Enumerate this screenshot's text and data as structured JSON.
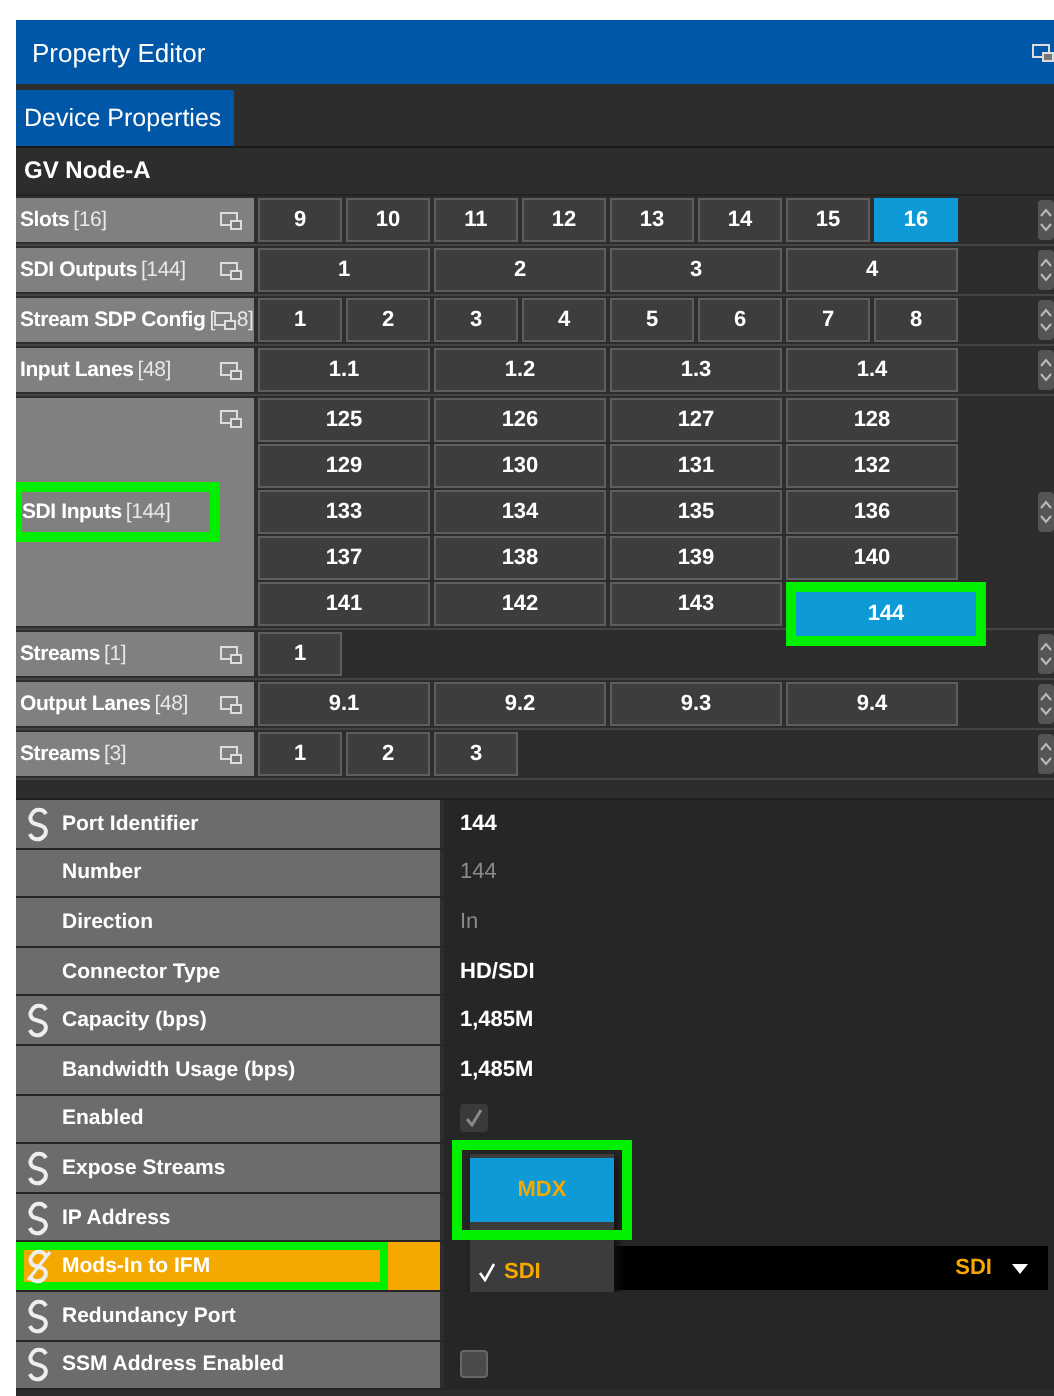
{
  "window": {
    "title": "Property Editor"
  },
  "tabs": [
    {
      "label": "Device Properties",
      "selected": true
    }
  ],
  "device": "GV Node-A",
  "grid": [
    {
      "label": "Slots",
      "count": "[16]",
      "cell_rows": [
        [
          {
            "text": "9",
            "selected": false
          },
          {
            "text": "10",
            "selected": false
          },
          {
            "text": "11",
            "selected": false
          },
          {
            "text": "12",
            "selected": false
          },
          {
            "text": "13",
            "selected": false
          },
          {
            "text": "14",
            "selected": false
          },
          {
            "text": "15",
            "selected": false
          },
          {
            "text": "16",
            "selected": true
          }
        ]
      ]
    },
    {
      "label": "SDI Outputs",
      "count": "[144]",
      "cell_rows": [
        [
          {
            "text": "1",
            "selected": false
          },
          {
            "text": "2",
            "selected": false
          },
          {
            "text": "3",
            "selected": false
          },
          {
            "text": "4",
            "selected": false
          }
        ]
      ]
    },
    {
      "label": "Stream SDP Config",
      "count": "[",
      "count_tail": "8]",
      "cell_rows": [
        [
          {
            "text": "1",
            "selected": false
          },
          {
            "text": "2",
            "selected": false
          },
          {
            "text": "3",
            "selected": false
          },
          {
            "text": "4",
            "selected": false
          },
          {
            "text": "5",
            "selected": false
          },
          {
            "text": "6",
            "selected": false
          },
          {
            "text": "7",
            "selected": false
          },
          {
            "text": "8",
            "selected": false
          }
        ]
      ]
    },
    {
      "label": "Input Lanes",
      "count": "[48]",
      "cell_rows": [
        [
          {
            "text": "1.1",
            "selected": false
          },
          {
            "text": "1.2",
            "selected": false
          },
          {
            "text": "1.3",
            "selected": false
          },
          {
            "text": "1.4",
            "selected": false
          }
        ]
      ]
    },
    {
      "label": "SDI Inputs",
      "count": "[144]",
      "highlighted": true,
      "cell_rows": [
        [
          {
            "text": "125",
            "selected": false
          },
          {
            "text": "126",
            "selected": false
          },
          {
            "text": "127",
            "selected": false
          },
          {
            "text": "128",
            "selected": false
          }
        ],
        [
          {
            "text": "129",
            "selected": false
          },
          {
            "text": "130",
            "selected": false
          },
          {
            "text": "131",
            "selected": false
          },
          {
            "text": "132",
            "selected": false
          }
        ],
        [
          {
            "text": "133",
            "selected": false
          },
          {
            "text": "134",
            "selected": false
          },
          {
            "text": "135",
            "selected": false
          },
          {
            "text": "136",
            "selected": false
          }
        ],
        [
          {
            "text": "137",
            "selected": false
          },
          {
            "text": "138",
            "selected": false
          },
          {
            "text": "139",
            "selected": false
          },
          {
            "text": "140",
            "selected": false
          }
        ],
        [
          {
            "text": "141",
            "selected": false
          },
          {
            "text": "142",
            "selected": false
          },
          {
            "text": "143",
            "selected": false
          },
          {
            "text": "144",
            "selected": true,
            "highlighted": true
          }
        ]
      ]
    },
    {
      "label": "Streams",
      "count": "[1]",
      "cell_rows": [
        [
          {
            "text": "1",
            "selected": false
          }
        ]
      ]
    },
    {
      "label": "Output Lanes",
      "count": "[48]",
      "cell_rows": [
        [
          {
            "text": "9.1",
            "selected": false
          },
          {
            "text": "9.2",
            "selected": false
          },
          {
            "text": "9.3",
            "selected": false
          },
          {
            "text": "9.4",
            "selected": false
          }
        ]
      ]
    },
    {
      "label": "Streams",
      "count": "[3]",
      "cell_rows": [
        [
          {
            "text": "1",
            "selected": false
          },
          {
            "text": "2",
            "selected": false
          },
          {
            "text": "3",
            "selected": false
          }
        ]
      ]
    }
  ],
  "properties": [
    {
      "label": "Port Identifier",
      "linked": true,
      "kind": "text",
      "value": "144",
      "readonly": false
    },
    {
      "label": "Number",
      "kind": "text",
      "value": "144",
      "readonly": true
    },
    {
      "label": "Direction",
      "kind": "text",
      "value": "In",
      "readonly": true
    },
    {
      "label": "Connector Type",
      "kind": "text",
      "value": "HD/SDI",
      "readonly": false
    },
    {
      "label": "Capacity (bps)",
      "linked": true,
      "kind": "text",
      "value": "1,485M",
      "readonly": false
    },
    {
      "label": "Bandwidth Usage (bps)",
      "kind": "text",
      "value": "1,485M",
      "readonly": false
    },
    {
      "label": "Enabled",
      "kind": "checkbox",
      "checked": true,
      "readonly": true
    },
    {
      "label": "Expose Streams",
      "linked": true,
      "kind": "empty"
    },
    {
      "label": "IP Address",
      "linked": true,
      "kind": "empty"
    },
    {
      "label": "Mods-In to IFM",
      "linked": false,
      "kind": "dropdown",
      "selected": true,
      "highlighted": true,
      "value": "SDI",
      "options": [
        {
          "label": "MDX",
          "selected": false,
          "hovered": true,
          "highlighted": true
        },
        {
          "label": "SDI",
          "selected": true,
          "hovered": false
        }
      ]
    },
    {
      "label": "Redundancy Port",
      "linked": true,
      "kind": "empty"
    },
    {
      "label": "SSM Address Enabled",
      "linked": true,
      "kind": "checkbox",
      "checked": false,
      "readonly": false
    }
  ]
}
